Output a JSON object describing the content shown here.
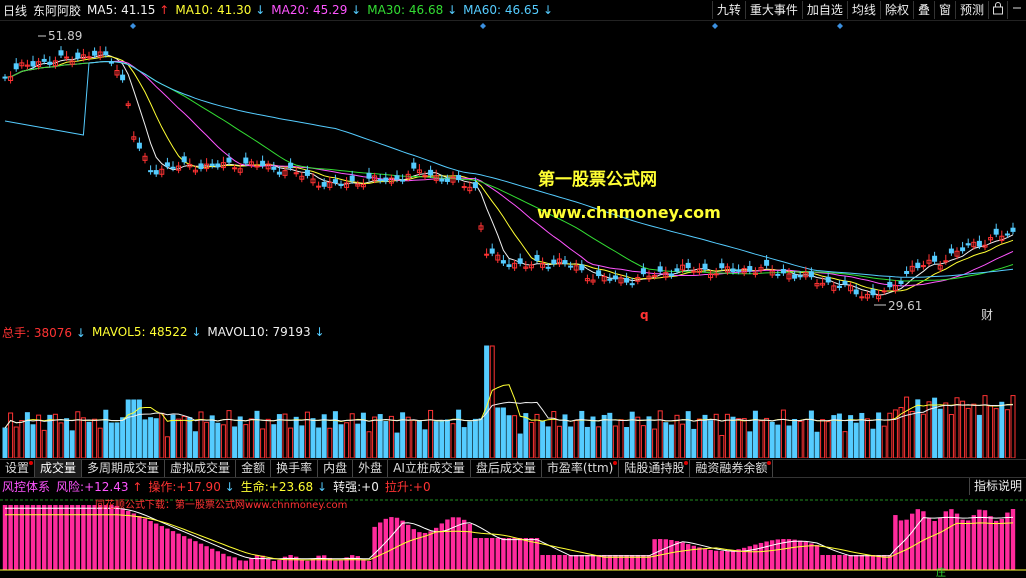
{
  "top_bar": {
    "period": "日线",
    "stock_name": "东阿阿胶",
    "ma": [
      {
        "label": "MA5: 41.15",
        "arrow": "↑",
        "color": "#f0f0f0"
      },
      {
        "label": "MA10: 41.30",
        "arrow": "↓",
        "color": "#ffff33"
      },
      {
        "label": "MA20: 45.29",
        "arrow": "↓",
        "color": "#ff55ff"
      },
      {
        "label": "MA30: 46.68",
        "arrow": "↓",
        "color": "#33dd33"
      },
      {
        "label": "MA60: 46.65",
        "arrow": "↓",
        "color": "#55ccff"
      }
    ],
    "buttons": [
      "九转",
      "重大事件",
      "加自选",
      "均线",
      "除权",
      "叠",
      "窗",
      "预测"
    ]
  },
  "price_chart": {
    "high_label": "51.89",
    "low_label": "29.61",
    "watermark_line1": "第一股票公式网",
    "watermark_line2": "www.chnmoney.com",
    "marker_q": "q",
    "marker_cai": "财"
  },
  "volume_bar": {
    "total": {
      "label": "总手: 38076",
      "arrow": "↓"
    },
    "mavol5": {
      "label": "MAVOL5: 48522",
      "arrow": "↓"
    },
    "mavol10": {
      "label": "MAVOL10: 79193",
      "arrow": "↓"
    }
  },
  "tabs": [
    {
      "label": "设置",
      "dot": true
    },
    {
      "label": "成交量",
      "dot": false,
      "active": true
    },
    {
      "label": "多周期成交量",
      "dot": false
    },
    {
      "label": "虚拟成交量",
      "dot": false
    },
    {
      "label": "金额",
      "dot": false
    },
    {
      "label": "换手率",
      "dot": false
    },
    {
      "label": "内盘",
      "dot": false
    },
    {
      "label": "外盘",
      "dot": false
    },
    {
      "label": "AI立桩成交量",
      "dot": false
    },
    {
      "label": "盘后成交量",
      "dot": false
    },
    {
      "label": "市盈率(ttm)",
      "dot": true
    },
    {
      "label": "陆股通持股",
      "dot": true
    },
    {
      "label": "融资融券余额",
      "dot": true
    }
  ],
  "indicator_bar": {
    "name": "风控体系",
    "risk": {
      "label": "风险:",
      "value": "+12.43",
      "arrow": "↑"
    },
    "op": {
      "label": "操作:",
      "value": "+17.90",
      "arrow": "↓"
    },
    "life": {
      "label": "生命:",
      "value": "+23.68",
      "arrow": "↓"
    },
    "strong": {
      "label": "转强:",
      "value": "+0"
    },
    "pull": {
      "label": "拉升:",
      "value": "+0"
    },
    "help_button": "指标说明"
  },
  "indicator_chart": {
    "watermark": "同花顺公式下载：第一股票公式网www.chnmoney.com",
    "marker_zhi": "庄"
  },
  "colors": {
    "up": "#ff3333",
    "down": "#55ccff",
    "ma5": "#f0f0f0",
    "ma10": "#ffff33",
    "ma20": "#ff55ff",
    "ma30": "#33dd33",
    "ma60": "#55ccff",
    "watermark": "#ffff33"
  }
}
